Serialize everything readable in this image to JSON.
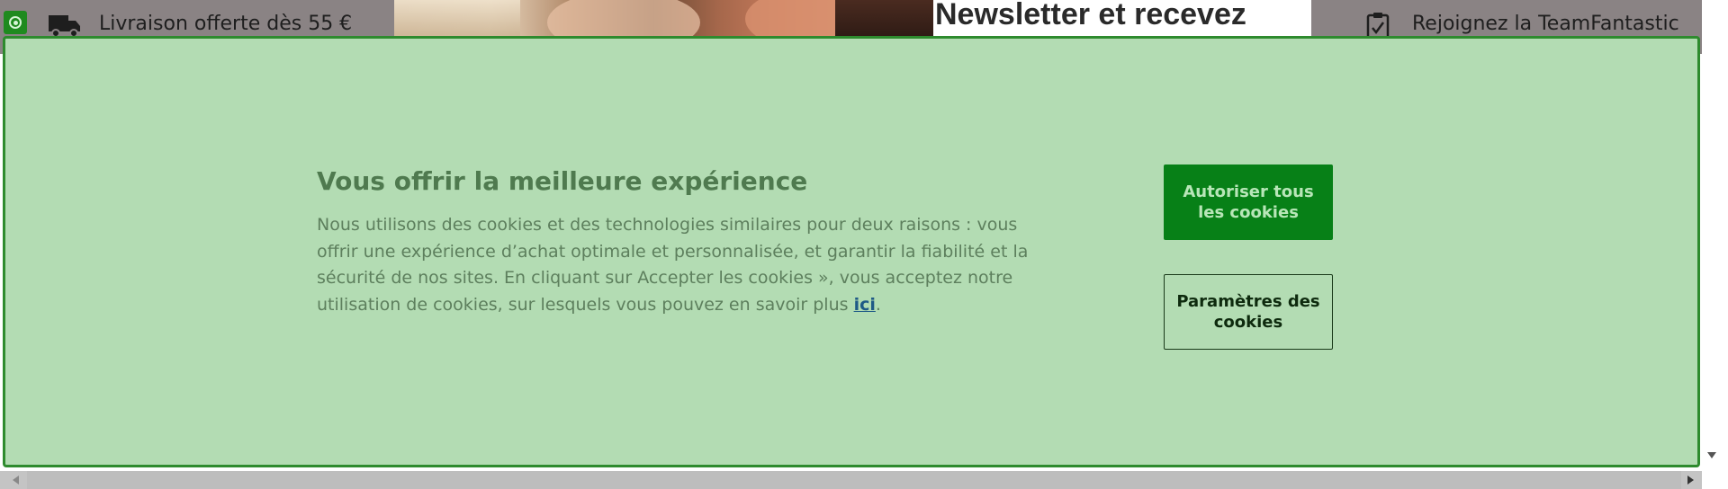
{
  "background_page": {
    "shipping_text": "Livraison offerte dès 55 €",
    "newsletter_title": "Newsletter et recevez",
    "team_text": "Rejoignez la TeamFantastic",
    "icons": [
      "truck-icon",
      "clipboard-check-icon",
      "consent-badge-icon"
    ]
  },
  "cookie_banner": {
    "title": "Vous offrir la meilleure expérience",
    "body_text": "Nous utilisons des cookies et des technologies similaires pour deux raisons : vous offrir une expérience d’achat optimale et personnalisée, et garantir la fiabilité et la sécurité de nos sites. En cliquant sur Accepter les cookies », vous acceptez notre utilisation de cookies, sur lesquels vous pouvez en savoir plus ",
    "link_text": "ici",
    "trailing": ".",
    "accept_all_label": "Autoriser tous les cookies",
    "settings_label": "Paramètres des cookies"
  },
  "colors": {
    "banner_bg": "#b3dcb3",
    "banner_border": "#2e8b2e",
    "accept_button": "#078017",
    "title_text": "#4f7a4f",
    "link": "#1f5a86"
  }
}
